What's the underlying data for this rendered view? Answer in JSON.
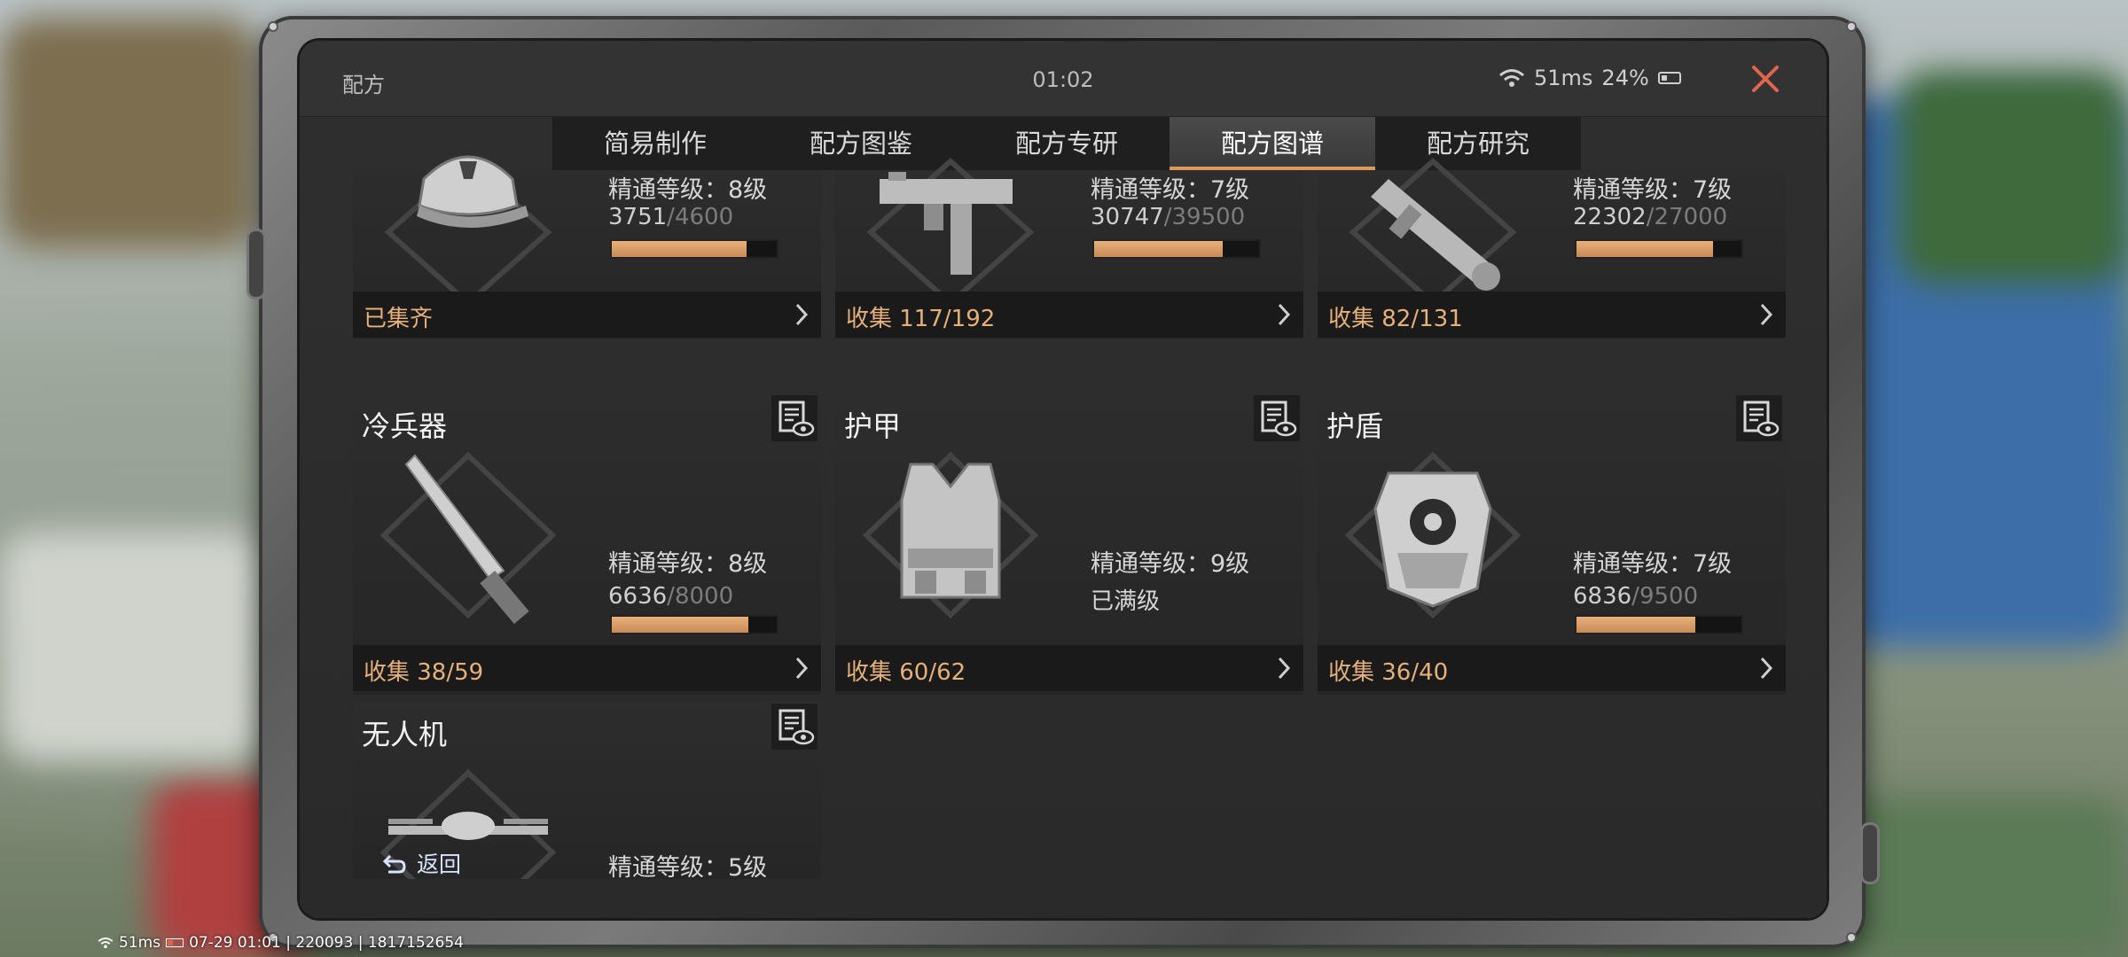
{
  "window": {
    "title": "配方",
    "clock": "01:02",
    "ping": "51ms",
    "battery": "24%"
  },
  "tabs": [
    {
      "label": "简易制作",
      "active": false
    },
    {
      "label": "配方图鉴",
      "active": false
    },
    {
      "label": "配方专研",
      "active": false
    },
    {
      "label": "配方图谱",
      "active": true
    },
    {
      "label": "配方研究",
      "active": false
    }
  ],
  "cards": [
    {
      "name": "",
      "mastery": "精通等级：8级",
      "progress": {
        "cur": "3751",
        "max": "4600",
        "fraction": 0.8154
      },
      "collect": "已集齐",
      "icon": "cap-icon"
    },
    {
      "name": "",
      "mastery": "精通等级：7级",
      "progress": {
        "cur": "30747",
        "max": "39500",
        "fraction": 0.7784
      },
      "collect": "收集 117/192",
      "icon": "smg-icon"
    },
    {
      "name": "",
      "mastery": "精通等级：7级",
      "progress": {
        "cur": "22302",
        "max": "27000",
        "fraction": 0.826
      },
      "collect": "收集 82/131",
      "icon": "launcher-icon"
    },
    {
      "name": "冷兵器",
      "mastery": "精通等级：8级",
      "progress": {
        "cur": "6636",
        "max": "8000",
        "fraction": 0.8295
      },
      "collect": "收集 38/59",
      "icon": "knife-icon"
    },
    {
      "name": "护甲",
      "mastery": "精通等级：9级",
      "maxed": "已满级",
      "collect": "收集 60/62",
      "icon": "vest-icon"
    },
    {
      "name": "护盾",
      "mastery": "精通等级：7级",
      "progress": {
        "cur": "6836",
        "max": "9500",
        "fraction": 0.7196
      },
      "collect": "收集 36/40",
      "icon": "shield-icon"
    },
    {
      "name": "无人机",
      "mastery": "精通等级：5级",
      "icon": "drone-icon"
    }
  ],
  "back_label": "返回",
  "hud": {
    "ping": "51ms",
    "info": "07-29 01:01 | 220093 | 1817152654"
  },
  "colors": {
    "accent": "#d99a5b",
    "collect_text": "#e6b07a",
    "close": "#e0654d"
  }
}
